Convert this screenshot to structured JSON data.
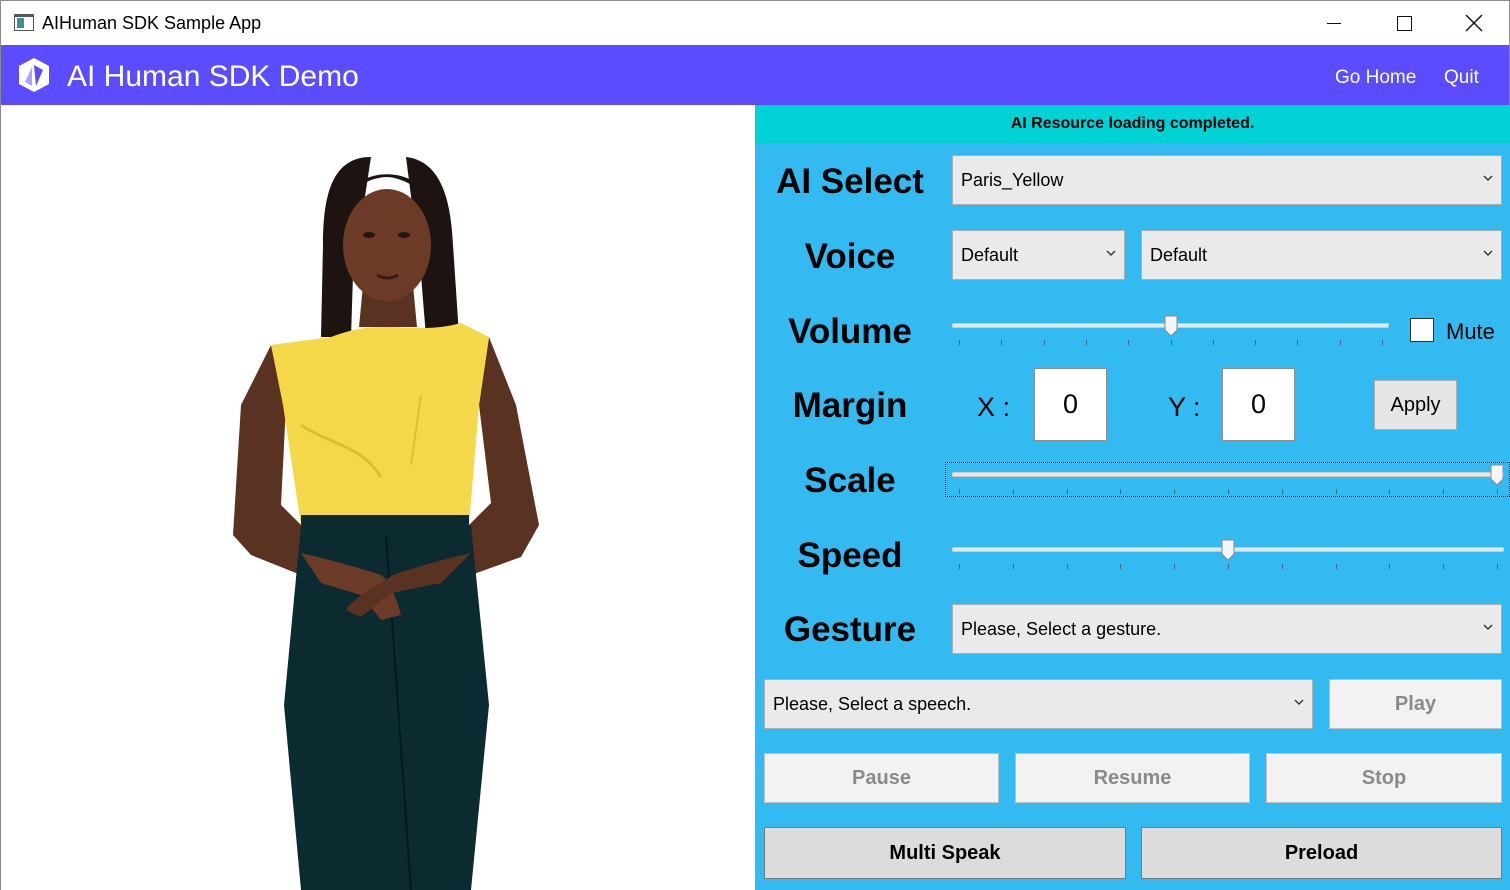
{
  "window": {
    "title": "AIHuman SDK Sample App"
  },
  "header": {
    "title": "AI Human SDK Demo",
    "nav": {
      "home": "Go Home",
      "quit": "Quit"
    },
    "color": "#5b4cff"
  },
  "panel": {
    "status": "AI Resource loading completed.",
    "labels": {
      "ai_select": "AI Select",
      "voice": "Voice",
      "volume": "Volume",
      "margin": "Margin",
      "scale": "Scale",
      "speed": "Speed",
      "gesture": "Gesture"
    },
    "ai_select": {
      "value": "Paris_Yellow"
    },
    "voice": {
      "language": "Default",
      "voice": "Default"
    },
    "volume": {
      "level": 0.5,
      "mute_label": "Mute",
      "muted": false
    },
    "margin": {
      "x_label": "X :",
      "y_label": "Y :",
      "x": "0",
      "y": "0",
      "apply": "Apply"
    },
    "scale": {
      "level": 1.0
    },
    "speed": {
      "level": 0.5
    },
    "gesture": {
      "placeholder": "Please, Select a gesture."
    },
    "speech": {
      "placeholder": "Please, Select a speech.",
      "play": "Play"
    },
    "controls": {
      "pause": "Pause",
      "resume": "Resume",
      "stop": "Stop"
    },
    "actions": {
      "multi_speak": "Multi Speak",
      "preload": "Preload"
    },
    "colors": {
      "background": "#33bbf1",
      "status": "#00d2d6"
    }
  }
}
